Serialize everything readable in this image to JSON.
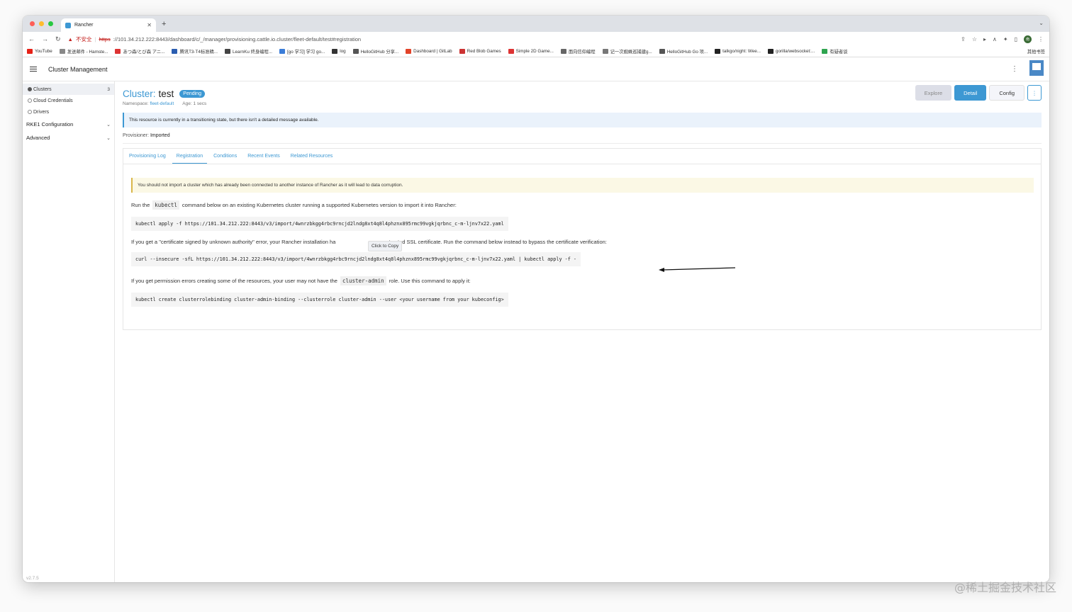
{
  "browser": {
    "tab_title": "Rancher",
    "new_tab": "+",
    "url_warning": "不安全",
    "url_scheme": "https",
    "url_rest": "://101.34.212.222:8443/dashboard/c/_/manager/provisioning.cattle.io.cluster/fleet-default/test#registration",
    "bookmarks": [
      "YouTube",
      "发送邮件 - Hamste...",
      "あつ森/とび森 アニ...",
      "腾讯T3-T4标准精...",
      "LearnKu 终身编程...",
      "[go 学习] 学习 go...",
      "log",
      "HelloGitHub 分享...",
      "Dashboard | GitLab",
      "Red Blob Games",
      "Simple 2D Game...",
      "面向信仰编程",
      "记一次蜘蛛巡捕建g...",
      "HelloGitHub Go 项...",
      "talkgo/night: Wee...",
      "gorilla/websocket:..."
    ],
    "bookmarks_more": "有疑者谈",
    "bookmarks_other": "其他书签",
    "avatar_initials": "南"
  },
  "header": {
    "title": "Cluster Management"
  },
  "sidebar": {
    "items": [
      {
        "label": "Clusters",
        "count": "3",
        "active": true
      },
      {
        "label": "Cloud Credentials"
      },
      {
        "label": "Drivers"
      }
    ],
    "groups": [
      {
        "label": "RKE1 Configuration"
      },
      {
        "label": "Advanced"
      }
    ],
    "version": "v2.7.5"
  },
  "page": {
    "title_prefix": "Cluster:",
    "title_name": "test",
    "status": "Pending",
    "namespace_label": "Namespace:",
    "namespace": "fleet-default",
    "age": "Age: 1 secs",
    "actions": {
      "explore": "Explore",
      "detail": "Detail",
      "config": "Config",
      "more": "⋮"
    },
    "transition_message": "This resource is currently in a transitioning state, but there isn't a detailed message available.",
    "provisioner_label": "Provisioner:",
    "provisioner": "Imported",
    "tabs": [
      "Provisioning Log",
      "Registration",
      "Conditions",
      "Recent Events",
      "Related Resources"
    ],
    "registration": {
      "warning": "You should not import a cluster which has already been connected to another instance of Rancher as it will lead to data corruption.",
      "run_pre": "Run the",
      "run_code": "kubectl",
      "run_post": "command below on an existing Kubernetes cluster running a supported Kubernetes version to import it into Rancher:",
      "cmd1": "kubectl apply -f https://101.34.212.222:8443/v3/import/4wnrzbkgg4rbc9rncjd2lndg8xt4q8l4phznx895rmc99vgkjqrbnc_c-m-ljnv7x22.yaml",
      "cert_pre": "If you get a \"certificate signed by unknown authority\" error, your Rancher installation ha",
      "cert_post": "or untrusted SSL certificate. Run the command below instead to bypass the certificate verification:",
      "tooltip": "Click to Copy",
      "cmd2": "curl --insecure -sfL https://101.34.212.222:8443/v3/import/4wnrzbkgg4rbc9rncjd2lndg8xt4q8l4phznx895rmc99vgkjqrbnc_c-m-ljnv7x22.yaml | kubectl apply -f -",
      "perm_pre": "If you get permission errors creating some of the resources, your user may not have the",
      "perm_code": "cluster-admin",
      "perm_post": "role. Use this command to apply it:",
      "cmd3": "kubectl create clusterrolebinding cluster-admin-binding --clusterrole cluster-admin --user <your username from your kubeconfig>"
    }
  },
  "watermark": "@稀土掘金技术社区"
}
